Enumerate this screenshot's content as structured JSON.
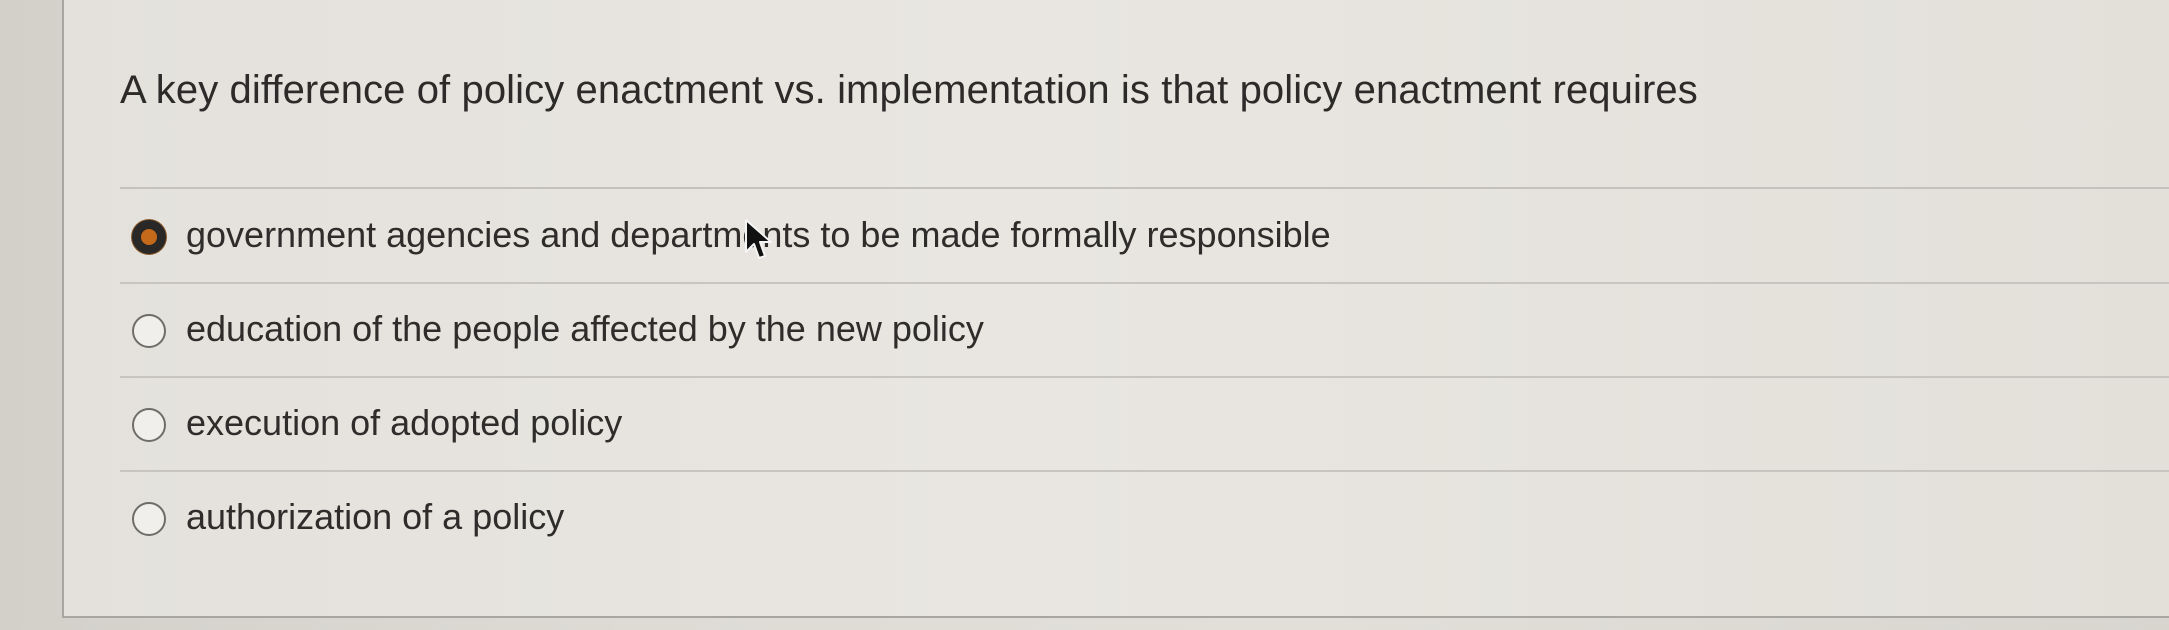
{
  "question": {
    "text": "A key difference of policy enactment vs. implementation is that policy enactment requires"
  },
  "answers": [
    {
      "label": "government agencies and departments to be made formally responsible",
      "selected": true
    },
    {
      "label": "education of the people affected by the new policy",
      "selected": false
    },
    {
      "label": "execution of adopted policy",
      "selected": false
    },
    {
      "label": "authorization of a policy",
      "selected": false
    }
  ],
  "colors": {
    "selected_radio_fill": "#c56a1a",
    "selected_radio_ring": "#2a2826",
    "text": "#2d2b29",
    "panel_background": "#e6e3de"
  },
  "icons": {
    "cursor": "mouse-pointer-icon"
  }
}
